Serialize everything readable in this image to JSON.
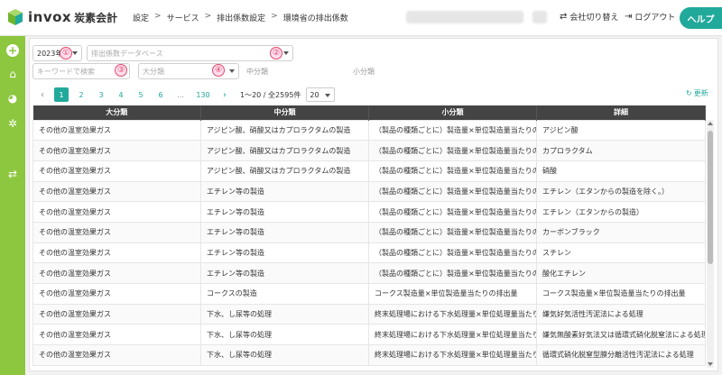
{
  "app": {
    "logo_text": "invox",
    "logo_sub": "炭素会計"
  },
  "breadcrumb": [
    "設定",
    "サービス",
    "排出係数設定",
    "環境省の排出係数"
  ],
  "header": {
    "switch_company": "会社切り替え",
    "logout": "ログアウト",
    "help": "ヘルプ"
  },
  "filters": {
    "year": "2023年",
    "database_placeholder": "排出係数データベース",
    "keyword_placeholder": "キーワードで検索",
    "major_placeholder": "大分類",
    "middle_label": "中分類",
    "minor_label": "小分類",
    "markers": [
      "①",
      "②",
      "③",
      "④"
    ]
  },
  "pagination": {
    "pages": [
      "1",
      "2",
      "3",
      "4",
      "5",
      "6",
      "...",
      "130"
    ],
    "info": "1〜20 / 全2595件",
    "per_page": "20",
    "refresh": "更新"
  },
  "table": {
    "headers": [
      "大分類",
      "中分類",
      "小分類",
      "詳細"
    ],
    "rows": [
      [
        "その他の温室効果ガス",
        "アジピン酸、硝酸又はカプロラクタムの製造",
        "（製品の種類ごとに）製造量×単位製造量当たりの排",
        "アジピン酸"
      ],
      [
        "その他の温室効果ガス",
        "アジピン酸、硝酸又はカプロラクタムの製造",
        "（製品の種類ごとに）製造量×単位製造量当たりの排",
        "カプロラクタム"
      ],
      [
        "その他の温室効果ガス",
        "アジピン酸、硝酸又はカプロラクタムの製造",
        "（製品の種類ごとに）製造量×単位製造量当たりの排",
        "硝酸"
      ],
      [
        "その他の温室効果ガス",
        "エチレン等の製造",
        "（製品の種類ごとに）製造量×単位製造量当たりの排",
        "エチレン（エタンからの製造を除く。）"
      ],
      [
        "その他の温室効果ガス",
        "エチレン等の製造",
        "（製品の種類ごとに）製造量×単位製造量当たりの排",
        "エチレン（エタンからの製造）"
      ],
      [
        "その他の温室効果ガス",
        "エチレン等の製造",
        "（製品の種類ごとに）製造量×単位製造量当たりの排",
        "カーボンブラック"
      ],
      [
        "その他の温室効果ガス",
        "エチレン等の製造",
        "（製品の種類ごとに）製造量×単位製造量当たりの排",
        "スチレン"
      ],
      [
        "その他の温室効果ガス",
        "エチレン等の製造",
        "（製品の種類ごとに）製造量×単位製造量当たりの排",
        "酸化エチレン"
      ],
      [
        "その他の温室効果ガス",
        "コークスの製造",
        "コークス製造量×単位製造量当たりの排出量",
        "コークス製造量×単位製造量当たりの排出量"
      ],
      [
        "その他の温室効果ガス",
        "下水、し尿等の処理",
        "終末処理場における下水処理量×単位処理量当たりの",
        "嫌気好気活性汚泥法による処理"
      ],
      [
        "その他の温室効果ガス",
        "下水、し尿等の処理",
        "終末処理場における下水処理量×単位処理量当たりの",
        "嫌気無酸素好気法又は循環式硝化脱窒法による処理"
      ],
      [
        "その他の温室効果ガス",
        "下水、し尿等の処理",
        "終末処理場における下水処理量×単位処理量当たりの",
        "循環式硝化脱窒型膜分離活性汚泥法による処理"
      ]
    ]
  },
  "colors": {
    "accent": "#21a99b",
    "sidebar": "#8dc63f",
    "header_dark": "#444444",
    "marker": "#e04a6a"
  }
}
